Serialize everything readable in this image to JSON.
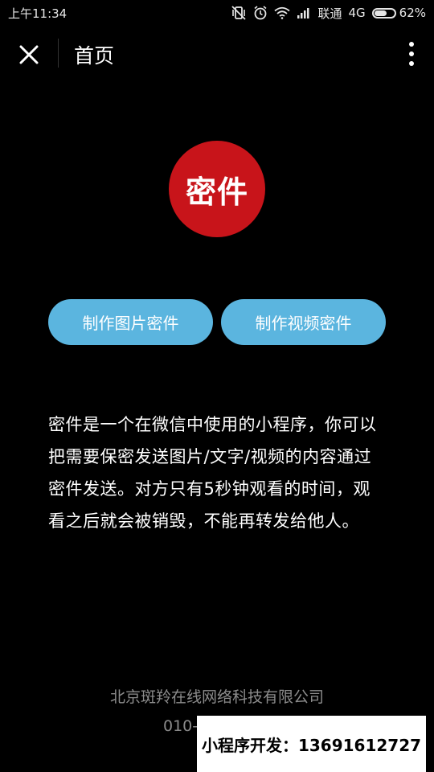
{
  "status_bar": {
    "time": "上午11:34",
    "carrier": "联通",
    "network": "4G",
    "battery_text": "62%",
    "battery_level": 0.62
  },
  "nav": {
    "title": "首页",
    "close_icon": "close-icon",
    "more_icon": "more-vertical-icon"
  },
  "logo": {
    "text": "密件",
    "color": "#c8141a"
  },
  "actions": {
    "image_label": "制作图片密件",
    "video_label": "制作视频密件",
    "color": "#5bb5df"
  },
  "description": "密件是一个在微信中使用的小程序，你可以把需要保密发送图片/文字/视频的内容通过密件发送。对方只有5秒钟观看的时间，观看之后就会被销毁，不能再转发给他人。",
  "footer": {
    "company": "北京斑羚在线网络科技有限公司",
    "phone_partial": "010-"
  },
  "watermark": {
    "text": "小程序开发：13691612727"
  }
}
